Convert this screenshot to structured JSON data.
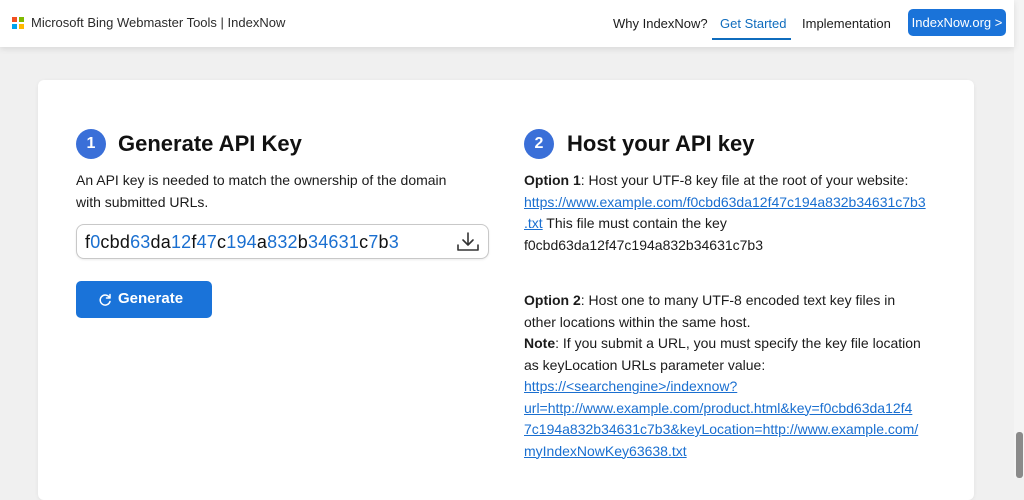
{
  "header": {
    "brand": "Microsoft Bing Webmaster Tools | IndexNow",
    "logo_colors": [
      "#f25022",
      "#7fba00",
      "#00a4ef",
      "#ffb900"
    ],
    "nav": [
      {
        "label": "Why IndexNow?"
      },
      {
        "label": "Get Started"
      },
      {
        "label": "Implementation"
      }
    ],
    "active_nav": "Get Started",
    "cta_label": "IndexNow.org >"
  },
  "step1": {
    "number": "1",
    "title": "Generate API Key",
    "desc_line1": "An API key is needed to match the ownership of the domain",
    "desc_line2": "with submitted URLs.",
    "api_key": "f0cbd63da12f47c194a832b34631c7b3",
    "download_icon": "download-icon",
    "generate_label": "Generate",
    "generate_icon": "refresh-icon"
  },
  "step2": {
    "number": "2",
    "title": "Host your API key",
    "option1_label": "Option 1",
    "option1_text": ": Host your UTF-8 key file at the root of your website:",
    "option1_link_line1": "https://www.example.com/f0cbd63da12f47c194a832b34631c7b3",
    "option1_link_line2": ".txt",
    "option1_after_link": " This file must contain the key",
    "option1_key": "f0cbd63da12f47c194a832b34631c7b3",
    "option2_label": "Option 2",
    "option2_text_line1": ": Host one to many UTF-8 encoded text key files in",
    "option2_text_line2": "other locations within the same host.",
    "note_label": "Note",
    "note_text_line1": ": If you submit a URL, you must specify the key file location",
    "note_text_line2": "as keyLocation URLs parameter value:",
    "note_link_lines": [
      "https://<searchengine>/indexnow?",
      "url=http://www.example.com/product.html&key=f0cbd63da12f4",
      "7c194a832b34631c7b3&keyLocation=http://www.example.com/",
      "myIndexNowKey63638.txt"
    ]
  },
  "colors": {
    "accent": "#1a73d9",
    "link": "#1a6fd0",
    "step_badge": "#3a6fd8",
    "key_digit": "#1a6fd0",
    "key_letter": "#111111"
  }
}
